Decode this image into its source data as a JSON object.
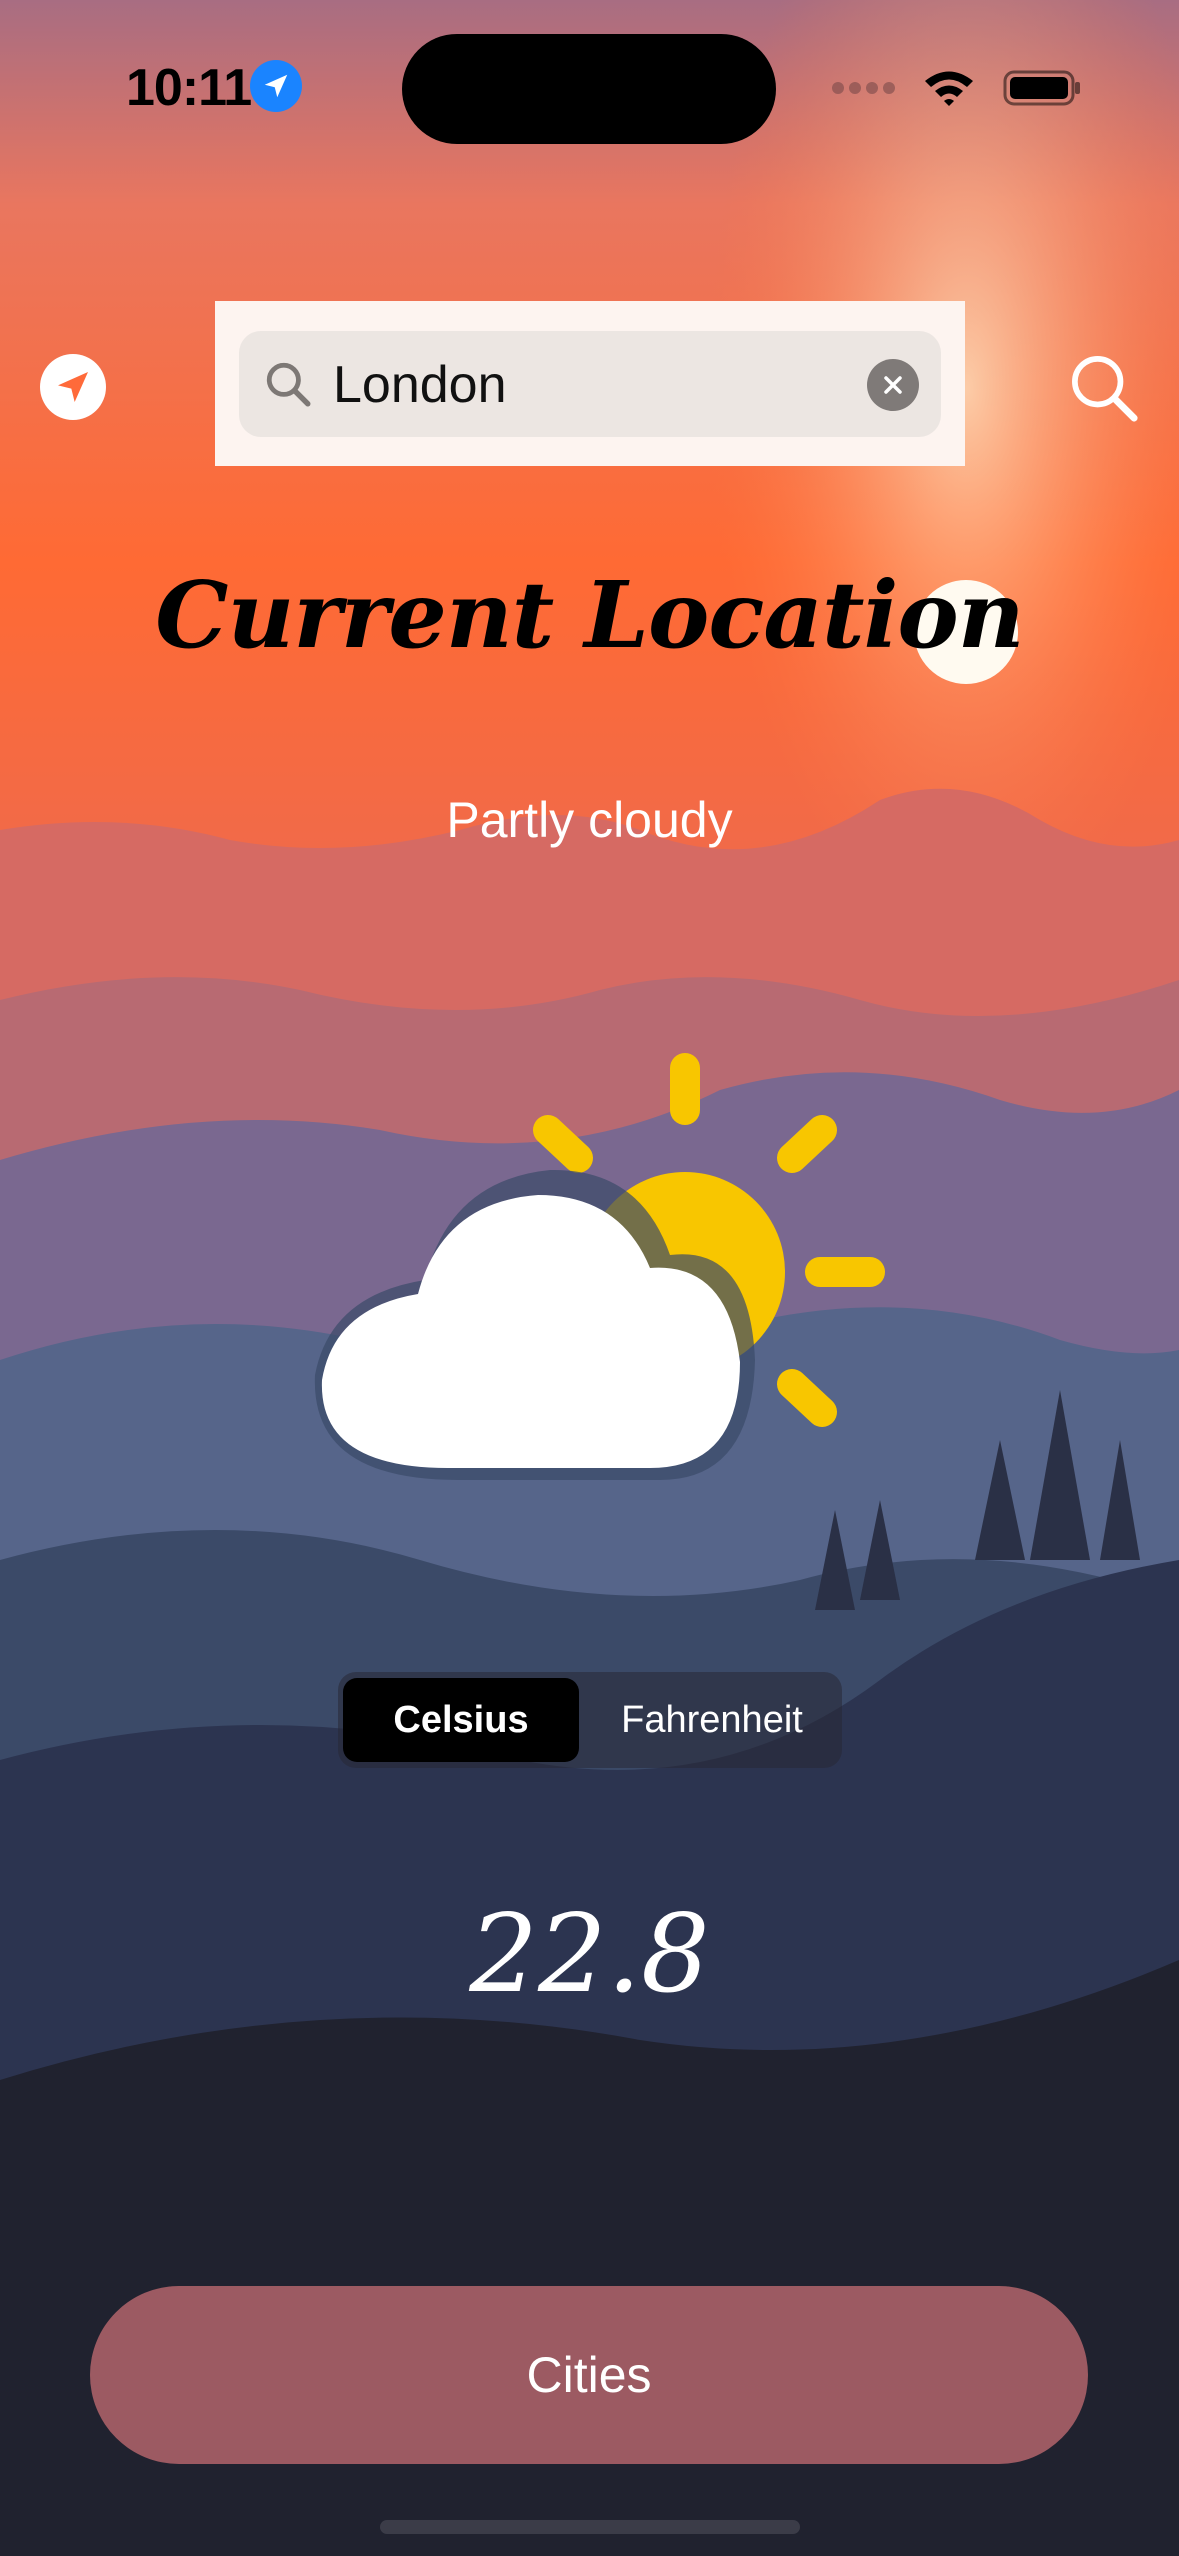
{
  "status_bar": {
    "time": "10:11",
    "icons": [
      "location-arrow-icon",
      "signal-dots-icon",
      "wifi-icon",
      "battery-icon"
    ]
  },
  "top_bar": {
    "left_icon": "location-arrow-icon",
    "search": {
      "value": "London",
      "placeholder": "",
      "icons": [
        "magnifier-icon",
        "clear-icon"
      ]
    },
    "right_icon": "search-icon"
  },
  "main": {
    "title": "Current Location",
    "condition": "Partly cloudy",
    "weather_icon": "partly-cloudy-icon",
    "units": {
      "options": [
        "Celsius",
        "Fahrenheit"
      ],
      "selected": "Celsius"
    },
    "temperature": "22.8"
  },
  "footer": {
    "cities_label": "Cities"
  },
  "colors": {
    "accent_button": "#9c5a62",
    "sun": "#f8c600",
    "location_badge": "#1a84ff",
    "sky_top": "#b06a78",
    "sky_mid": "#ff6b3a"
  }
}
